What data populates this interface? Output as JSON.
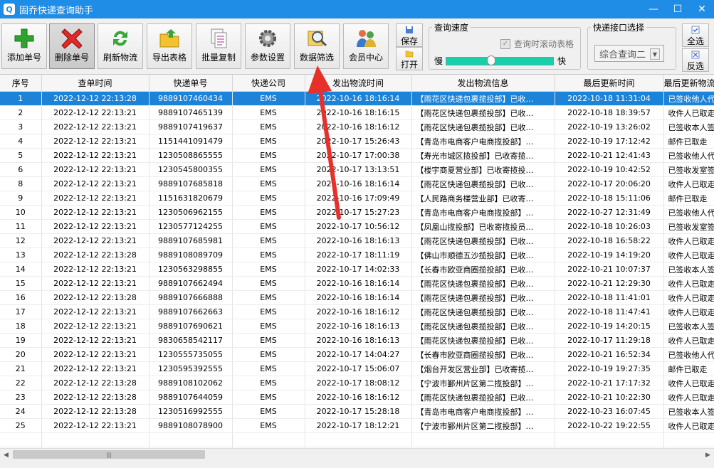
{
  "window": {
    "title": "固乔快递查询助手",
    "controls": {
      "minimize": "—",
      "maximize": "☐",
      "close": "✕"
    }
  },
  "toolbar": {
    "buttons": [
      {
        "label": "添加单号",
        "icon": "add-plus-icon"
      },
      {
        "label": "删除单号",
        "icon": "delete-x-icon"
      },
      {
        "label": "刷新物流",
        "icon": "refresh-icon"
      },
      {
        "label": "导出表格",
        "icon": "export-folder-icon"
      },
      {
        "label": "批量复制",
        "icon": "copy-icon"
      },
      {
        "label": "参数设置",
        "icon": "settings-gear-icon"
      },
      {
        "label": "数据筛选",
        "icon": "search-filter-icon"
      },
      {
        "label": "会员中心",
        "icon": "member-users-icon"
      }
    ],
    "save_label": "保存",
    "open_label": "打开",
    "speed_group": {
      "legend": "查询速度",
      "scroll_checkbox_label": "查询时滚动表格",
      "scroll_checkbox_checked": true,
      "slow_label": "慢",
      "fast_label": "快",
      "speed_level": 0.42
    },
    "api_group": {
      "legend": "快递接口选择",
      "selected": "综合查询二"
    },
    "select_all_label": "全选",
    "invert_label": "反选"
  },
  "table": {
    "columns": [
      "序号",
      "查单时间",
      "快递单号",
      "快递公司",
      "发出物流时间",
      "发出物流信息",
      "最后更新时间",
      "最后更新物流"
    ],
    "selected_row": 0,
    "rows": [
      [
        "1",
        "2022-12-12 22:13:28",
        "9889107460434",
        "EMS",
        "2022-10-16 18:16:14",
        "【雨花区快递包裹揽投部】已收…",
        "2022-10-18 11:31:04",
        "已签收他人代"
      ],
      [
        "2",
        "2022-12-12 22:13:21",
        "9889107465139",
        "EMS",
        "2022-10-16 18:16:15",
        "【雨花区快递包裹揽投部】已收…",
        "2022-10-18 18:39:57",
        "收件人已取走"
      ],
      [
        "3",
        "2022-12-12 22:13:21",
        "9889107419637",
        "EMS",
        "2022-10-16 18:16:12",
        "【雨花区快递包裹揽投部】已收…",
        "2022-10-19 13:26:02",
        "已签收本人签"
      ],
      [
        "4",
        "2022-12-12 22:13:21",
        "1151441091479",
        "EMS",
        "2022-10-17 15:26:43",
        "【青岛市电商客户电商揽投部】…",
        "2022-10-19 17:12:42",
        "邮件已取走"
      ],
      [
        "5",
        "2022-12-12 22:13:21",
        "1230508865555",
        "EMS",
        "2022-10-17 17:00:38",
        "【寿光市城区揽投部】已收寄揽…",
        "2022-10-21 12:41:43",
        "已签收他人代"
      ],
      [
        "6",
        "2022-12-12 22:13:21",
        "1230545800355",
        "EMS",
        "2022-10-17 13:13:51",
        "【楼宇商夏营业部】已收寄揽投…",
        "2022-10-19 10:42:52",
        "已签收发室签"
      ],
      [
        "8",
        "2022-12-12 22:13:21",
        "9889107685818",
        "EMS",
        "2022-10-16 18:16:14",
        "【雨花区快递包裹揽投部】已收…",
        "2022-10-17 20:06:20",
        "收件人已取走"
      ],
      [
        "9",
        "2022-12-12 22:13:21",
        "1151631820679",
        "EMS",
        "2022-10-16 17:09:49",
        "【人民路商务楼营业部】已收寄…",
        "2022-10-18 15:11:06",
        "邮件已取走"
      ],
      [
        "10",
        "2022-12-12 22:13:21",
        "1230506962155",
        "EMS",
        "2022-10-17 15:27:23",
        "【青岛市电商客户电商揽投部】…",
        "2022-10-27 12:31:49",
        "已签收他人代"
      ],
      [
        "11",
        "2022-12-12 22:13:21",
        "1230577124255",
        "EMS",
        "2022-10-17 10:56:12",
        "【凤凰山揽投部】已收寄揽投员…",
        "2022-10-18 10:26:03",
        "已签收发室签"
      ],
      [
        "12",
        "2022-12-12 22:13:21",
        "9889107685981",
        "EMS",
        "2022-10-16 18:16:13",
        "【雨花区快递包裹揽投部】已收…",
        "2022-10-18 16:58:22",
        "收件人已取走"
      ],
      [
        "13",
        "2022-12-12 22:13:28",
        "9889108089709",
        "EMS",
        "2022-10-17 18:11:19",
        "【佛山市顺德五沙揽投部】已收…",
        "2022-10-19 14:19:20",
        "收件人已取走"
      ],
      [
        "14",
        "2022-12-12 22:13:21",
        "1230563298855",
        "EMS",
        "2022-10-17 14:02:33",
        "【长春市欧亚商圈揽投部】已收…",
        "2022-10-21 10:07:37",
        "已签收本人签"
      ],
      [
        "15",
        "2022-12-12 22:13:21",
        "9889107662494",
        "EMS",
        "2022-10-16 18:16:14",
        "【雨花区快递包裹揽投部】已收…",
        "2022-10-21 12:29:30",
        "收件人已取走"
      ],
      [
        "16",
        "2022-12-12 22:13:28",
        "9889107666888",
        "EMS",
        "2022-10-16 18:16:14",
        "【雨花区快递包裹揽投部】已收…",
        "2022-10-18 11:41:01",
        "收件人已取走"
      ],
      [
        "17",
        "2022-12-12 22:13:21",
        "9889107662663",
        "EMS",
        "2022-10-16 18:16:12",
        "【雨花区快递包裹揽投部】已收…",
        "2022-10-18 11:47:41",
        "收件人已取走"
      ],
      [
        "18",
        "2022-12-12 22:13:21",
        "9889107690621",
        "EMS",
        "2022-10-16 18:16:13",
        "【雨花区快递包裹揽投部】已收…",
        "2022-10-19 14:20:15",
        "已签收本人签"
      ],
      [
        "19",
        "2022-12-12 22:13:21",
        "9830658542117",
        "EMS",
        "2022-10-16 18:16:13",
        "【雨花区快递包裹揽投部】已收…",
        "2022-10-17 11:29:18",
        "收件人已取走"
      ],
      [
        "20",
        "2022-12-12 22:13:21",
        "1230555735055",
        "EMS",
        "2022-10-17 14:04:27",
        "【长春市欧亚商圈揽投部】已收…",
        "2022-10-21 16:52:34",
        "已签收他人代"
      ],
      [
        "21",
        "2022-12-12 22:13:21",
        "1230595392555",
        "EMS",
        "2022-10-17 15:06:07",
        "【烟台开发区营业部】已收寄揽…",
        "2022-10-19 19:27:35",
        "邮件已取走"
      ],
      [
        "22",
        "2022-12-12 22:13:28",
        "9889108102062",
        "EMS",
        "2022-10-17 18:08:12",
        "【宁波市鄞州片区第二揽投部】…",
        "2022-10-21 17:17:32",
        "收件人已取走"
      ],
      [
        "23",
        "2022-12-12 22:13:28",
        "9889107644059",
        "EMS",
        "2022-10-16 18:16:12",
        "【雨花区快递包裹揽投部】已收…",
        "2022-10-21 10:22:30",
        "收件人已取走"
      ],
      [
        "24",
        "2022-12-12 22:13:28",
        "1230516992555",
        "EMS",
        "2022-10-17 15:28:18",
        "【青岛市电商客户电商揽投部】…",
        "2022-10-23 16:07:45",
        "已签收本人签"
      ],
      [
        "25",
        "2022-12-12 22:13:21",
        "9889108078900",
        "EMS",
        "2022-10-17 18:12:21",
        "【宁波市鄞州片区第二揽投部】…",
        "2022-10-22 19:22:55",
        "收件人已取走"
      ]
    ]
  },
  "scrollbar": {
    "left_arrow": "◀",
    "right_arrow": "▶",
    "thumb_grip": "|||"
  },
  "colors": {
    "titlebar": "#1f8de6",
    "selected_row": "#1c83d8",
    "slider_fill": "#17d0a8",
    "annotation_arrow": "#e8302a"
  }
}
